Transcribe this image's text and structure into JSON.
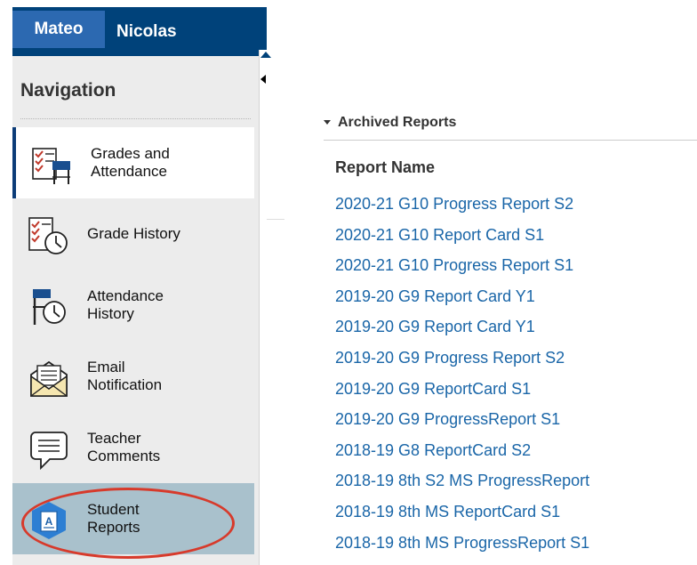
{
  "tabs": {
    "active": "Mateo",
    "other": "Nicolas"
  },
  "navigation": {
    "heading": "Navigation",
    "items": [
      {
        "line1": "Grades and",
        "line2": "Attendance",
        "icon": "grades-attendance-icon"
      },
      {
        "line1": "Grade History",
        "line2": "",
        "icon": "grade-history-icon"
      },
      {
        "line1": "Attendance",
        "line2": "History",
        "icon": "attendance-history-icon"
      },
      {
        "line1": "Email",
        "line2": "Notification",
        "icon": "email-notification-icon"
      },
      {
        "line1": "Teacher",
        "line2": "Comments",
        "icon": "teacher-comments-icon"
      },
      {
        "line1": "Student",
        "line2": "Reports",
        "icon": "student-reports-icon"
      }
    ]
  },
  "archived": {
    "title": "Archived Reports",
    "column_header": "Report Name",
    "reports": [
      "2020-21 G10 Progress Report S2",
      "2020-21 G10 Report Card S1",
      "2020-21 G10 Progress Report S1",
      "2019-20 G9 Report Card Y1",
      "2019-20 G9 Report Card Y1",
      "2019-20 G9 Progress Report S2",
      "2019-20 G9 ReportCard S1",
      "2019-20 G9 ProgressReport S1",
      "2018-19 G8 ReportCard S2",
      "2018-19 8th S2 MS ProgressReport",
      "2018-19 8th MS ReportCard S1",
      "2018-19 8th MS ProgressReport S1"
    ]
  },
  "colors": {
    "header_bg": "#00427a",
    "active_tab": "#2c69b1",
    "link": "#1a66a8",
    "selected_item_bg": "#a9c1cc",
    "annotation_oval": "#d73a2b"
  }
}
